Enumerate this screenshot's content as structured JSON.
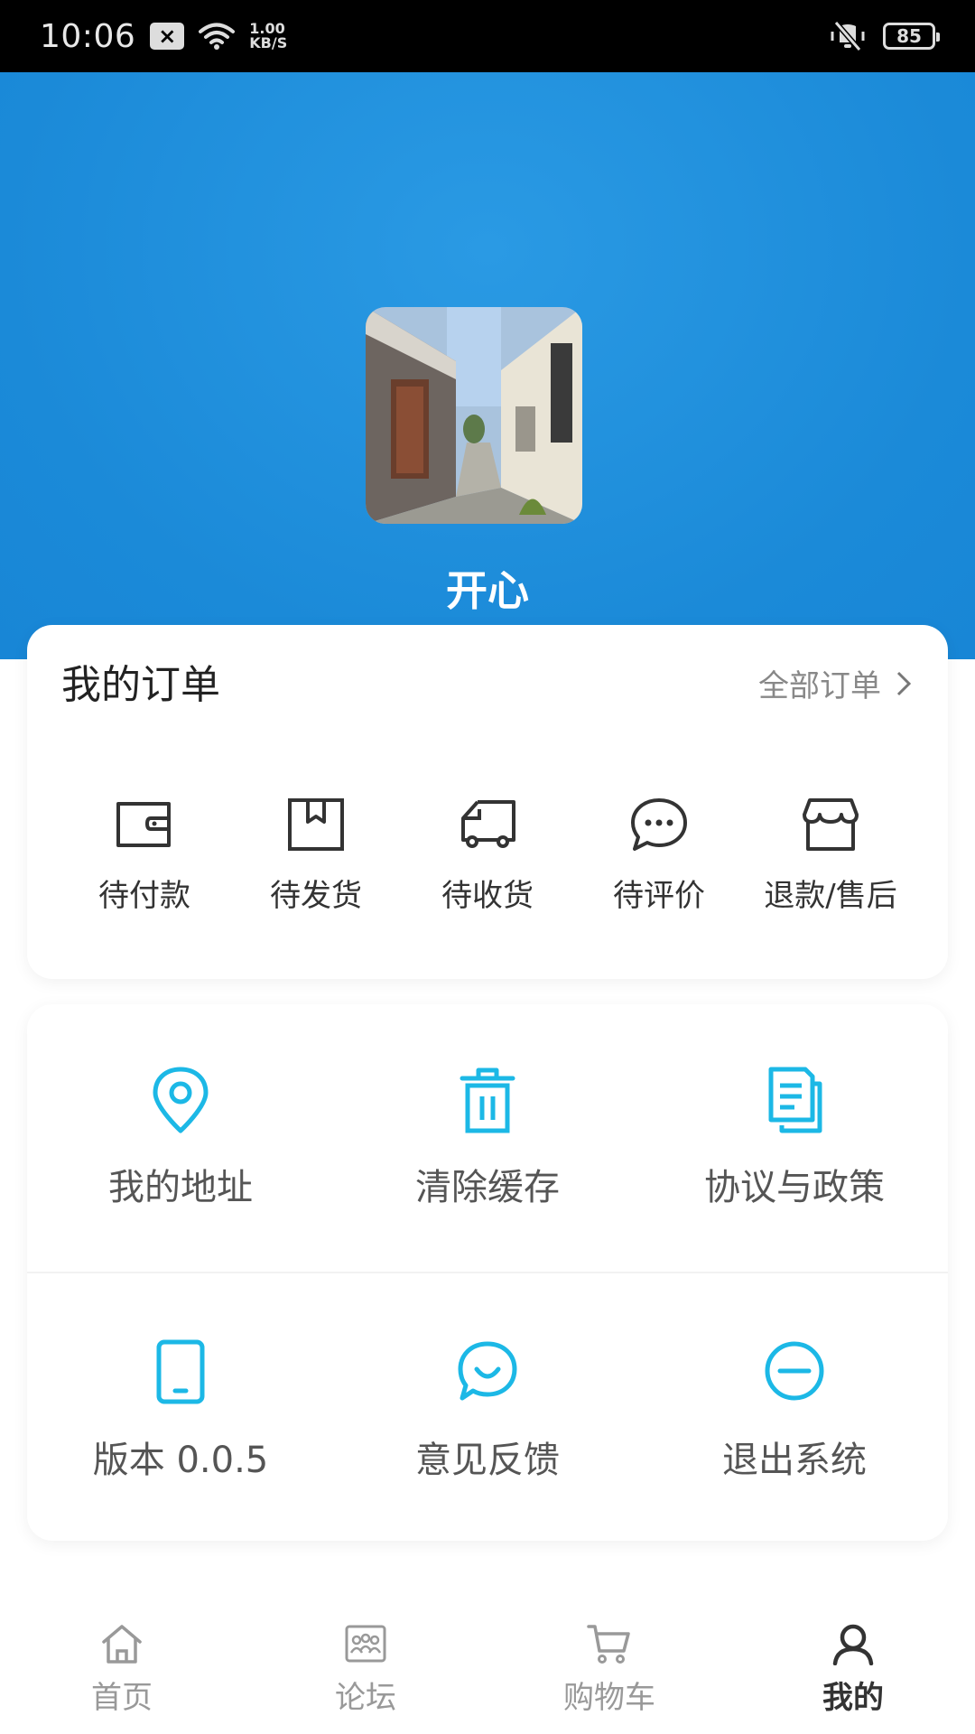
{
  "status_bar": {
    "time": "10:06",
    "notification": "×",
    "net_speed_value": "1.00",
    "net_speed_unit": "KB/S",
    "battery": "85"
  },
  "profile": {
    "username": "开心"
  },
  "orders": {
    "title": "我的订单",
    "all_link": "全部订单",
    "items": [
      {
        "label": "待付款",
        "icon": "wallet-icon"
      },
      {
        "label": "待发货",
        "icon": "package-icon"
      },
      {
        "label": "待收货",
        "icon": "truck-icon"
      },
      {
        "label": "待评价",
        "icon": "chat-bubble-icon"
      },
      {
        "label": "退款/售后",
        "icon": "store-icon"
      }
    ]
  },
  "tools": {
    "items": [
      {
        "label": "我的地址",
        "icon": "location-pin-icon"
      },
      {
        "label": "清除缓存",
        "icon": "trash-icon"
      },
      {
        "label": "协议与政策",
        "icon": "document-icon"
      },
      {
        "label": "版本 0.0.5",
        "icon": "tablet-icon"
      },
      {
        "label": "意见反馈",
        "icon": "feedback-icon"
      },
      {
        "label": "退出系统",
        "icon": "minus-circle-icon"
      }
    ],
    "accent_color": "#1cb8e6"
  },
  "bottom_nav": {
    "items": [
      {
        "label": "首页",
        "icon": "home-icon"
      },
      {
        "label": "论坛",
        "icon": "forum-icon"
      },
      {
        "label": "购物车",
        "icon": "cart-icon"
      },
      {
        "label": "我的",
        "icon": "user-icon"
      }
    ],
    "active_index": 3
  },
  "colors": {
    "header_blue": "#1b8ad8",
    "icon_cyan": "#1cb8e6",
    "icon_dark": "#333333"
  }
}
